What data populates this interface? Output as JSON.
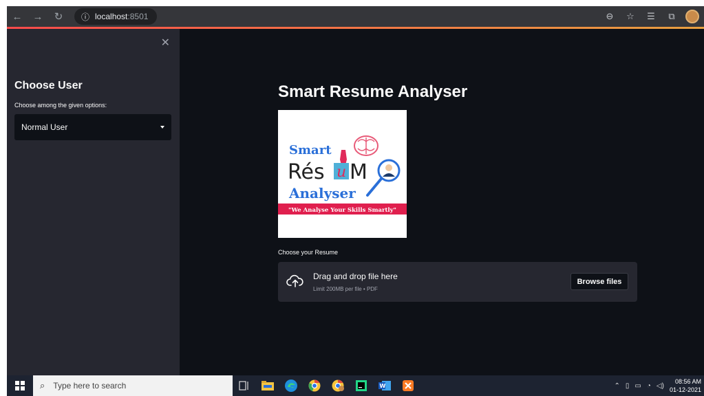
{
  "browser": {
    "url_host": "localhost",
    "url_port": ":8501"
  },
  "sidebar": {
    "title": "Choose User",
    "select_label": "Choose among the given options:",
    "select_value": "Normal User"
  },
  "main": {
    "title": "Smart Resume Analyser",
    "logo": {
      "line1": "Smart",
      "line2_pre": "Rés",
      "line2_u": "u",
      "line2_m": "M",
      "line3": "Analyser",
      "banner": "\"We Analyse Your Skills Smartly\""
    },
    "uploader": {
      "label": "Choose your Resume",
      "drop_text": "Drag and drop file here",
      "limit_text": "Limit 200MB per file • PDF",
      "browse_label": "Browse files"
    }
  },
  "taskbar": {
    "search_placeholder": "Type here to search",
    "time": "08:56 AM",
    "date": "01-12-2021"
  },
  "colors": {
    "sidebar_bg": "#262730",
    "main_bg": "#0e1117",
    "accent": "#ff4b4b"
  }
}
